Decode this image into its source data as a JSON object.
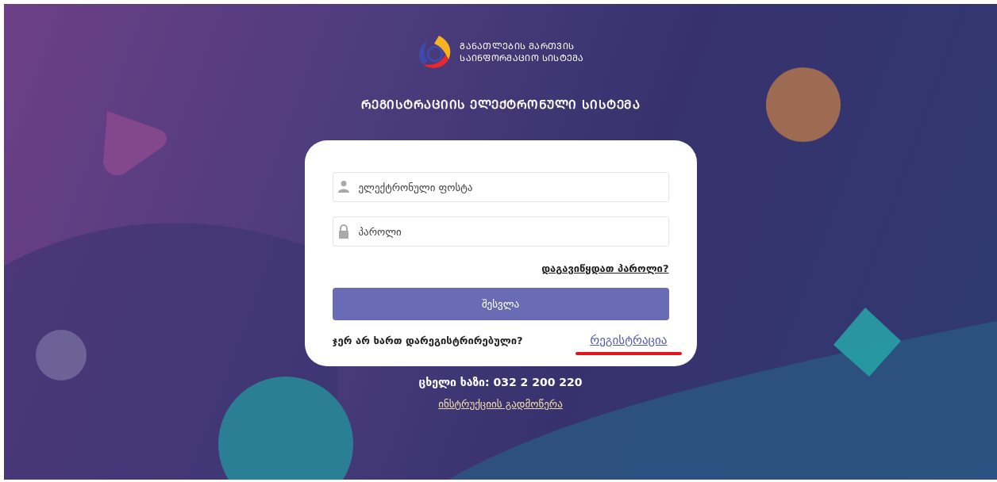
{
  "logo": {
    "line_1": "ᲒᲐᲜᲐᲗᲚᲔᲑᲘᲡ ᲛᲐᲠᲗᲕᲘᲡ",
    "line_2": "ᲡᲐᲘᲜᲤᲝᲠᲛᲐᲪᲘᲝ ᲡᲘᲡᲢᲔᲛᲐ"
  },
  "title": "ᲠᲔᲒᲘᲡᲢᲠᲐᲪᲘᲘᲡ ᲔᲚᲔᲥᲢᲠᲝᲜᲣᲚᲘ ᲡᲘᲡᲢᲔᲛᲐ",
  "login_form": {
    "email": {
      "placeholder": "ელექტრონული ფოსტა"
    },
    "password": {
      "placeholder": "პაროლი"
    },
    "forgot_link": "დაგავიწყდათ პაროლი?",
    "login_button": "შესვლა",
    "register_prompt": "ჯერ არ ხართ დარეგისტრირებული?",
    "register_link": "რეგისტრაცია"
  },
  "hotline": "ცხელი ხაზი: 032 2 200 220",
  "instructions_link": "ინსტრუქციის გადმოწერა"
}
